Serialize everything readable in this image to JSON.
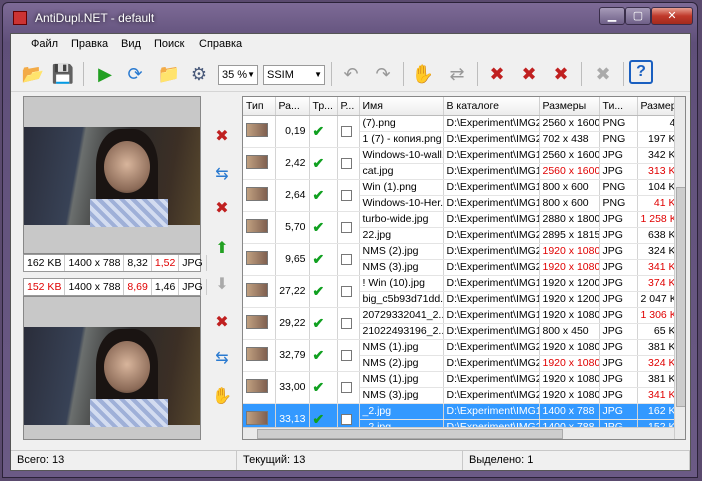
{
  "window": {
    "title": "AntiDupl.NET - default",
    "min": "▁",
    "max": "▢",
    "close": "✕"
  },
  "menu": [
    "Файл",
    "Правка",
    "Вид",
    "Поиск",
    "Справка"
  ],
  "toolbar": {
    "zoom": "35 %",
    "algorithm": "SSIM"
  },
  "left": {
    "top_info": [
      "162 KB",
      "1400 x 788",
      "8,32",
      "1,52",
      "JPG"
    ],
    "bottom_info": [
      "152 KB",
      "1400 x 788",
      "8,69",
      "1,46",
      "JPG"
    ]
  },
  "grid": {
    "headers": [
      "Тип",
      "Ра...",
      "Тр...",
      "Р...",
      "Имя",
      "В каталоге",
      "Размеры",
      "Ти...",
      "Размер"
    ],
    "rows": [
      [
        "0,19",
        [
          "(7).png",
          "1 (7) - копия.png"
        ],
        [
          "D:\\Experiment\\IMG2",
          "D:\\Experiment\\IMG2"
        ],
        [
          "2560 x 1600",
          "702 x 438"
        ],
        [
          "PNG",
          "PNG"
        ],
        [
          "4",
          "197 K"
        ]
      ],
      [
        "2,42",
        [
          "Windows-10-wall...",
          "cat.jpg"
        ],
        [
          "D:\\Experiment\\IMG1",
          "D:\\Experiment\\IMG1"
        ],
        [
          "2560 x 1600",
          "2560 x 1600"
        ],
        [
          "JPG",
          "JPG"
        ],
        [
          "342 K",
          "313 K"
        ]
      ],
      [
        "2,64",
        [
          "Win (1).png",
          "Windows-10-Her..."
        ],
        [
          "D:\\Experiment\\IMG1",
          "D:\\Experiment\\IMG1"
        ],
        [
          "800 x 600",
          "800 x 600"
        ],
        [
          "PNG",
          "PNG"
        ],
        [
          "104 K",
          "41 K"
        ]
      ],
      [
        "5,70",
        [
          "turbo-wide.jpg",
          "22.jpg"
        ],
        [
          "D:\\Experiment\\IMG1",
          "D:\\Experiment\\IMG2"
        ],
        [
          "2880 x 1800",
          "2895 x 1815"
        ],
        [
          "JPG",
          "JPG"
        ],
        [
          "1 258 K",
          "638 K"
        ]
      ],
      [
        "9,65",
        [
          "NMS (2).jpg",
          "NMS (3).jpg"
        ],
        [
          "D:\\Experiment\\IMG2",
          "D:\\Experiment\\IMG2"
        ],
        [
          "1920 x 1080",
          "1920 x 1080"
        ],
        [
          "JPG",
          "JPG"
        ],
        [
          "324 K",
          "341 K"
        ]
      ],
      [
        "27,22",
        [
          "! Win (10).jpg",
          "big_c5b93d71dd..."
        ],
        [
          "D:\\Experiment\\IMG1",
          "D:\\Experiment\\IMG1"
        ],
        [
          "1920 x 1200",
          "1920 x 1200"
        ],
        [
          "JPG",
          "JPG"
        ],
        [
          "374 K",
          "2 047 K"
        ]
      ],
      [
        "29,22",
        [
          "20729332041_2...",
          "21022493196_2..."
        ],
        [
          "D:\\Experiment\\IMG1",
          "D:\\Experiment\\IMG1"
        ],
        [
          "1920 x 1080",
          "800 x 450"
        ],
        [
          "JPG",
          "JPG"
        ],
        [
          "1 306 K",
          "65 K"
        ]
      ],
      [
        "32,79",
        [
          "NMS (1).jpg",
          "NMS (2).jpg"
        ],
        [
          "D:\\Experiment\\IMG2",
          "D:\\Experiment\\IMG2"
        ],
        [
          "1920 x 1080",
          "1920 x 1080"
        ],
        [
          "JPG",
          "JPG"
        ],
        [
          "381 K",
          "324 K"
        ]
      ],
      [
        "33,00",
        [
          "NMS (1).jpg",
          "NMS (3).jpg"
        ],
        [
          "D:\\Experiment\\IMG2",
          "D:\\Experiment\\IMG2"
        ],
        [
          "1920 x 1080",
          "1920 x 1080"
        ],
        [
          "JPG",
          "JPG"
        ],
        [
          "381 K",
          "341 K"
        ]
      ],
      [
        "33,13",
        [
          "_2.jpg",
          "_2.jpg"
        ],
        [
          "D:\\Experiment\\IMG1",
          "D:\\Experiment\\IMG2"
        ],
        [
          "1400 x 788",
          "1400 x 788"
        ],
        [
          "JPG",
          "JPG"
        ],
        [
          "162 K",
          "152 K"
        ]
      ]
    ],
    "red_cells": [
      [
        1,
        3,
        1
      ],
      [
        1,
        5,
        1
      ],
      [
        2,
        5,
        1
      ],
      [
        3,
        5,
        0
      ],
      [
        4,
        3,
        0
      ],
      [
        4,
        3,
        1
      ],
      [
        4,
        5,
        1
      ],
      [
        5,
        5,
        0
      ],
      [
        6,
        5,
        0
      ],
      [
        7,
        3,
        1
      ],
      [
        7,
        5,
        1
      ],
      [
        8,
        5,
        1
      ],
      [
        9,
        5,
        1
      ]
    ],
    "selected_index": 9
  },
  "status": {
    "total": "Всего: 13",
    "current": "Текущий: 13",
    "selected": "Выделено: 1"
  }
}
